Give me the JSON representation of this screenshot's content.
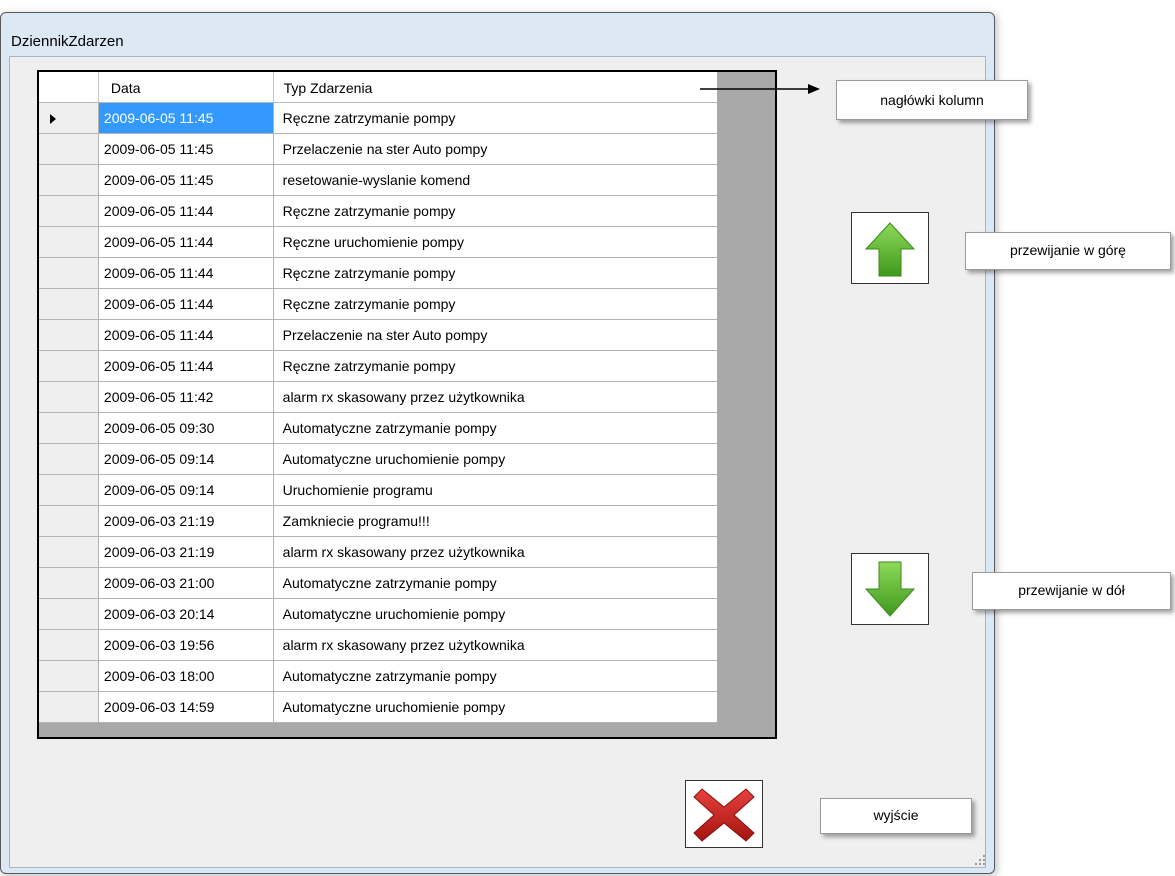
{
  "window": {
    "title": "DziennikZdarzen"
  },
  "grid": {
    "columns": [
      "Data",
      "Typ Zdarzenia"
    ],
    "selected_row": 0,
    "rows": [
      {
        "date": "2009-06-05 11:45",
        "event": "Ręczne zatrzymanie pompy"
      },
      {
        "date": "2009-06-05 11:45",
        "event": "Przelaczenie na ster Auto pompy"
      },
      {
        "date": "2009-06-05 11:45",
        "event": "resetowanie-wyslanie komend"
      },
      {
        "date": "2009-06-05 11:44",
        "event": "Ręczne zatrzymanie pompy"
      },
      {
        "date": "2009-06-05 11:44",
        "event": "Ręczne uruchomienie pompy"
      },
      {
        "date": "2009-06-05 11:44",
        "event": "Ręczne zatrzymanie pompy"
      },
      {
        "date": "2009-06-05 11:44",
        "event": "Ręczne zatrzymanie pompy"
      },
      {
        "date": "2009-06-05 11:44",
        "event": "Przelaczenie na ster Auto pompy"
      },
      {
        "date": "2009-06-05 11:44",
        "event": "Ręczne zatrzymanie pompy"
      },
      {
        "date": "2009-06-05 11:42",
        "event": "alarm rx skasowany przez użytkownika"
      },
      {
        "date": "2009-06-05 09:30",
        "event": "Automatyczne zatrzymanie pompy"
      },
      {
        "date": "2009-06-05 09:14",
        "event": "Automatyczne uruchomienie pompy"
      },
      {
        "date": "2009-06-05 09:14",
        "event": "Uruchomienie programu"
      },
      {
        "date": "2009-06-03 21:19",
        "event": "Zamkniecie programu!!!"
      },
      {
        "date": "2009-06-03 21:19",
        "event": "alarm rx skasowany przez użytkownika"
      },
      {
        "date": "2009-06-03 21:00",
        "event": "Automatyczne zatrzymanie pompy"
      },
      {
        "date": "2009-06-03 20:14",
        "event": "Automatyczne uruchomienie pompy"
      },
      {
        "date": "2009-06-03 19:56",
        "event": "alarm rx skasowany przez użytkownika"
      },
      {
        "date": "2009-06-03 18:00",
        "event": "Automatyczne zatrzymanie pompy"
      },
      {
        "date": "2009-06-03 14:59",
        "event": "Automatyczne uruchomienie pompy"
      }
    ]
  },
  "callouts": {
    "headers": "nagłówki kolumn",
    "scroll_up": "przewijanie w górę",
    "scroll_down": "przewijanie w dół",
    "exit": "wyjście"
  },
  "icons": {
    "scroll_up": "arrow-up-icon",
    "scroll_down": "arrow-down-icon",
    "exit": "close-icon"
  },
  "colors": {
    "selection": "#3399ff",
    "arrow_green": "#5cb82a",
    "exit_red": "#c8201e"
  }
}
